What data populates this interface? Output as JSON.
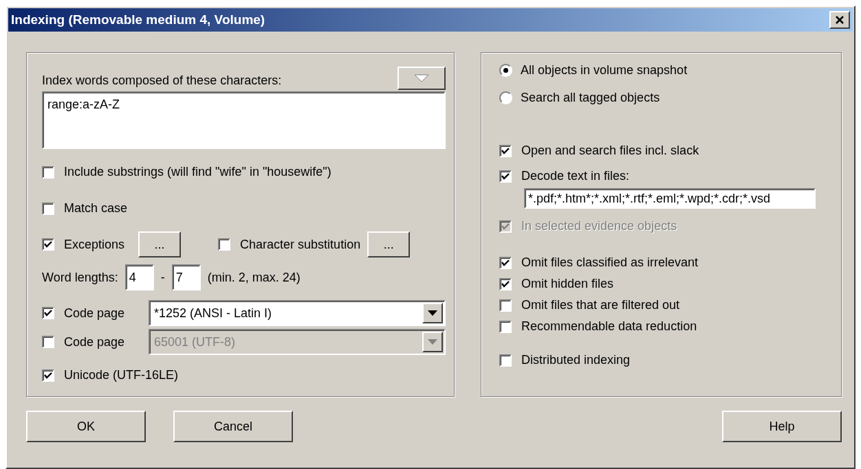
{
  "window": {
    "title": "Indexing (Removable medium 4, Volume)"
  },
  "left_panel": {
    "characters_label": "Index words composed of these characters:",
    "characters_field": {
      "value": "range:a-zA-Z"
    },
    "include_substrings": {
      "label": "Include substrings (will find \"wife\" in \"housewife\")",
      "checked": false
    },
    "match_case": {
      "label": "Match case",
      "checked": false
    },
    "exceptions": {
      "label": "Exceptions",
      "checked": true,
      "button": "..."
    },
    "character_substitution": {
      "label": "Character substitution",
      "checked": false,
      "button": "..."
    },
    "word_lengths": {
      "label": "Word lengths:",
      "min": "4",
      "separator": "-",
      "max": "7",
      "hint": "(min. 2, max. 24)"
    },
    "code_pages": [
      {
        "label": "Code page",
        "checked": true,
        "value": "*1252 (ANSI - Latin I)",
        "disabled": false
      },
      {
        "label": "Code page",
        "checked": false,
        "value": "65001 (UTF-8)",
        "disabled": true
      }
    ],
    "unicode": {
      "label": "Unicode (UTF-16LE)",
      "checked": true
    }
  },
  "right_panel": {
    "scope": [
      {
        "label": "All objects in volume snapshot",
        "selected": true
      },
      {
        "label": "Search all tagged objects",
        "selected": false
      }
    ],
    "open_and_search": {
      "label": "Open and search files incl. slack",
      "checked": true
    },
    "decode_text": {
      "label": "Decode text in files:",
      "checked": true,
      "field": "*.pdf;*.htm*;*.xml;*.rtf;*.eml;*.wpd;*.cdr;*.vsd"
    },
    "in_selected_evidence": {
      "label": "In selected evidence objects",
      "checked": true,
      "disabled": true
    },
    "omit_options": [
      {
        "label": "Omit files classified as irrelevant",
        "checked": true
      },
      {
        "label": "Omit hidden files",
        "checked": true
      },
      {
        "label": "Omit files that are filtered out",
        "checked": false
      },
      {
        "label": "Recommendable data reduction",
        "checked": false
      }
    ],
    "distributed_indexing": {
      "label": "Distributed indexing",
      "checked": false
    }
  },
  "buttons": [
    {
      "label": "OK",
      "kind": "left"
    },
    {
      "label": "Cancel",
      "kind": "left"
    },
    {
      "label": "Help",
      "kind": "right"
    }
  ]
}
